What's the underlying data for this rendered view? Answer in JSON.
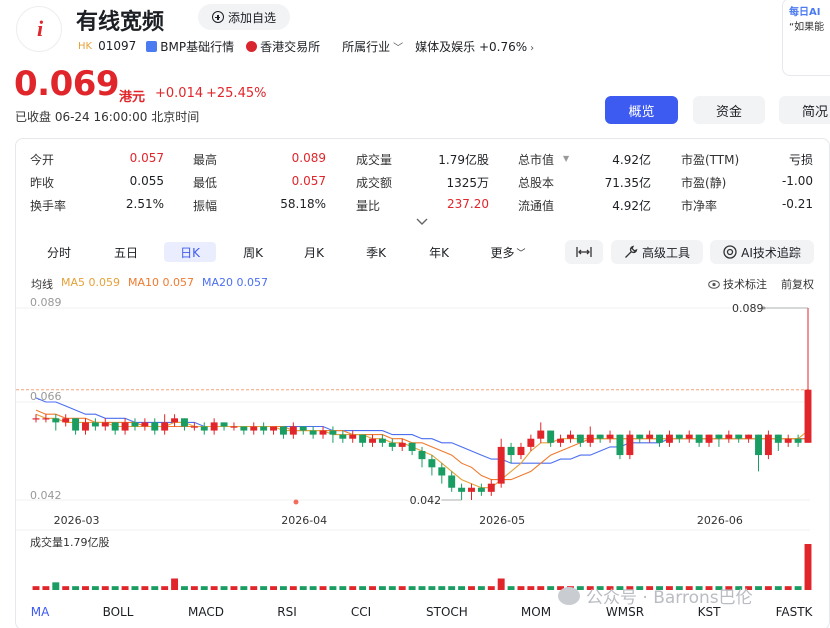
{
  "header": {
    "logo_text": "i",
    "stock_name": "有线宽频",
    "add_watchlist": "添加自选",
    "market_tag": "HK",
    "code": "01097",
    "quote_source": "BMP基础行情",
    "exchange": "香港交易所",
    "industry_label": "所属行业",
    "industry_value": "媒体及娱乐 +0.76%",
    "side_card_title": "每日AI",
    "side_card_text": "“如果能"
  },
  "price": {
    "last": "0.069",
    "unit": "港元",
    "change": "+0.014",
    "change_pct": "+25.45%",
    "status": "已收盘 06-24 16:00:00 北京时间"
  },
  "tabs": {
    "overview": "概览",
    "funds": "资金",
    "brief": "简况"
  },
  "quote": {
    "rows": [
      [
        {
          "label": "今开",
          "value": "0.057",
          "color": "red"
        },
        {
          "label": "最高",
          "value": "0.089",
          "color": "red"
        },
        {
          "label": "成交量",
          "value": "1.79亿股",
          "color": "black"
        },
        {
          "label": "总市值",
          "value": "4.92亿",
          "color": "black"
        },
        {
          "label": "市盈(TTM)",
          "value": "亏损",
          "color": "black"
        }
      ],
      [
        {
          "label": "昨收",
          "value": "0.055",
          "color": "black"
        },
        {
          "label": "最低",
          "value": "0.057",
          "color": "red"
        },
        {
          "label": "成交额",
          "value": "1325万",
          "color": "black"
        },
        {
          "label": "总股本",
          "value": "71.35亿",
          "color": "black"
        },
        {
          "label": "市盈(静)",
          "value": "-1.00",
          "color": "black"
        }
      ],
      [
        {
          "label": "换手率",
          "value": "2.51%",
          "color": "black"
        },
        {
          "label": "振幅",
          "value": "58.18%",
          "color": "black"
        },
        {
          "label": "量比",
          "value": "237.20",
          "color": "red"
        },
        {
          "label": "流通值",
          "value": "4.92亿",
          "color": "black"
        },
        {
          "label": "市净率",
          "value": "-0.21",
          "color": "black"
        }
      ]
    ]
  },
  "periods": [
    "分时",
    "五日",
    "日K",
    "周K",
    "月K",
    "季K",
    "年K",
    "更多"
  ],
  "active_period": "日K",
  "tools": {
    "fit": "",
    "advanced": "高级工具",
    "ai_trace": "AI技术追踪"
  },
  "legend": {
    "ma_title": "均线",
    "ma5": "MA5 0.059",
    "ma10": "MA10 0.057",
    "ma20": "MA20 0.057",
    "tech_note": "技术标注",
    "adjust": "前复权",
    "ma5_color": "#e5a13a",
    "ma10_color": "#f07a2e",
    "ma20_color": "#4b6ff0"
  },
  "chart_data": {
    "type": "candlestick",
    "y_ticks": [
      "0.089",
      "0.066",
      "0.042"
    ],
    "x_ticks": [
      "2026-03",
      "2026-04",
      "2026-05",
      "2026-06"
    ],
    "high_label": "0.089",
    "low_label": "0.042",
    "volume_label": "成交量1.79亿股",
    "up_color": "#e0262b",
    "down_color": "#1a9d63",
    "candles": [
      [
        0.062,
        0.062,
        0.063,
        0.061
      ],
      [
        0.062,
        0.062,
        0.063,
        0.061
      ],
      [
        0.062,
        0.061,
        0.063,
        0.059
      ],
      [
        0.061,
        0.062,
        0.063,
        0.06
      ],
      [
        0.062,
        0.059,
        0.062,
        0.058
      ],
      [
        0.059,
        0.061,
        0.062,
        0.058
      ],
      [
        0.061,
        0.06,
        0.062,
        0.059
      ],
      [
        0.06,
        0.061,
        0.062,
        0.059
      ],
      [
        0.061,
        0.059,
        0.061,
        0.058
      ],
      [
        0.059,
        0.061,
        0.062,
        0.058
      ],
      [
        0.061,
        0.06,
        0.062,
        0.059
      ],
      [
        0.06,
        0.061,
        0.062,
        0.059
      ],
      [
        0.061,
        0.059,
        0.062,
        0.058
      ],
      [
        0.059,
        0.061,
        0.063,
        0.058
      ],
      [
        0.061,
        0.062,
        0.063,
        0.06
      ],
      [
        0.062,
        0.06,
        0.062,
        0.059
      ],
      [
        0.06,
        0.06,
        0.061,
        0.059
      ],
      [
        0.06,
        0.059,
        0.061,
        0.058
      ],
      [
        0.059,
        0.061,
        0.062,
        0.058
      ],
      [
        0.061,
        0.06,
        0.061,
        0.059
      ],
      [
        0.06,
        0.06,
        0.061,
        0.059
      ],
      [
        0.06,
        0.059,
        0.06,
        0.058
      ],
      [
        0.059,
        0.06,
        0.061,
        0.058
      ],
      [
        0.06,
        0.059,
        0.061,
        0.058
      ],
      [
        0.059,
        0.06,
        0.06,
        0.058
      ],
      [
        0.06,
        0.058,
        0.06,
        0.057
      ],
      [
        0.058,
        0.06,
        0.061,
        0.057
      ],
      [
        0.06,
        0.059,
        0.06,
        0.058
      ],
      [
        0.059,
        0.058,
        0.06,
        0.057
      ],
      [
        0.058,
        0.059,
        0.06,
        0.057
      ],
      [
        0.059,
        0.058,
        0.06,
        0.056
      ],
      [
        0.058,
        0.057,
        0.059,
        0.056
      ],
      [
        0.057,
        0.058,
        0.059,
        0.056
      ],
      [
        0.058,
        0.056,
        0.058,
        0.055
      ],
      [
        0.056,
        0.057,
        0.058,
        0.055
      ],
      [
        0.057,
        0.056,
        0.058,
        0.055
      ],
      [
        0.056,
        0.055,
        0.057,
        0.054
      ],
      [
        0.055,
        0.056,
        0.057,
        0.054
      ],
      [
        0.056,
        0.054,
        0.056,
        0.053
      ],
      [
        0.054,
        0.052,
        0.055,
        0.05
      ],
      [
        0.052,
        0.05,
        0.053,
        0.048
      ],
      [
        0.05,
        0.048,
        0.051,
        0.046
      ],
      [
        0.048,
        0.045,
        0.049,
        0.044
      ],
      [
        0.045,
        0.044,
        0.046,
        0.042
      ],
      [
        0.044,
        0.045,
        0.046,
        0.042
      ],
      [
        0.045,
        0.044,
        0.046,
        0.043
      ],
      [
        0.044,
        0.046,
        0.047,
        0.043
      ],
      [
        0.046,
        0.055,
        0.057,
        0.045
      ],
      [
        0.055,
        0.053,
        0.056,
        0.051
      ],
      [
        0.053,
        0.055,
        0.056,
        0.052
      ],
      [
        0.055,
        0.057,
        0.058,
        0.054
      ],
      [
        0.057,
        0.059,
        0.061,
        0.056
      ],
      [
        0.059,
        0.056,
        0.059,
        0.055
      ],
      [
        0.056,
        0.057,
        0.058,
        0.055
      ],
      [
        0.057,
        0.058,
        0.059,
        0.056
      ],
      [
        0.058,
        0.056,
        0.058,
        0.055
      ],
      [
        0.056,
        0.058,
        0.06,
        0.055
      ],
      [
        0.058,
        0.057,
        0.058,
        0.056
      ],
      [
        0.057,
        0.058,
        0.059,
        0.056
      ],
      [
        0.058,
        0.053,
        0.058,
        0.052
      ],
      [
        0.053,
        0.058,
        0.059,
        0.052
      ],
      [
        0.058,
        0.057,
        0.058,
        0.056
      ],
      [
        0.057,
        0.058,
        0.059,
        0.056
      ],
      [
        0.058,
        0.056,
        0.058,
        0.055
      ],
      [
        0.056,
        0.058,
        0.059,
        0.055
      ],
      [
        0.058,
        0.057,
        0.058,
        0.056
      ],
      [
        0.057,
        0.058,
        0.059,
        0.056
      ],
      [
        0.058,
        0.056,
        0.058,
        0.055
      ],
      [
        0.056,
        0.058,
        0.058,
        0.055
      ],
      [
        0.058,
        0.057,
        0.058,
        0.055
      ],
      [
        0.057,
        0.058,
        0.059,
        0.056
      ],
      [
        0.058,
        0.057,
        0.058,
        0.056
      ],
      [
        0.057,
        0.058,
        0.058,
        0.056
      ],
      [
        0.058,
        0.053,
        0.058,
        0.049
      ],
      [
        0.053,
        0.058,
        0.059,
        0.052
      ],
      [
        0.058,
        0.056,
        0.058,
        0.054
      ],
      [
        0.056,
        0.057,
        0.058,
        0.055
      ],
      [
        0.057,
        0.056,
        0.058,
        0.055
      ],
      [
        0.056,
        0.069,
        0.089,
        0.056
      ]
    ],
    "ma5": [
      0.063,
      0.062,
      0.062,
      0.061,
      0.061,
      0.061,
      0.061,
      0.061,
      0.06,
      0.06,
      0.06,
      0.06,
      0.06,
      0.06,
      0.061,
      0.061,
      0.06,
      0.06,
      0.06,
      0.06,
      0.06,
      0.06,
      0.06,
      0.06,
      0.06,
      0.059,
      0.059,
      0.059,
      0.059,
      0.059,
      0.058,
      0.058,
      0.058,
      0.058,
      0.057,
      0.057,
      0.056,
      0.056,
      0.055,
      0.054,
      0.053,
      0.051,
      0.049,
      0.047,
      0.046,
      0.045,
      0.045,
      0.047,
      0.049,
      0.051,
      0.054,
      0.056,
      0.056,
      0.057,
      0.057,
      0.057,
      0.057,
      0.057,
      0.057,
      0.057,
      0.057,
      0.057,
      0.057,
      0.057,
      0.057,
      0.057,
      0.057,
      0.057,
      0.057,
      0.057,
      0.057,
      0.057,
      0.057,
      0.057,
      0.057,
      0.057,
      0.057,
      0.057,
      0.059
    ],
    "ma10": [
      0.064,
      0.063,
      0.063,
      0.062,
      0.062,
      0.062,
      0.061,
      0.061,
      0.061,
      0.061,
      0.061,
      0.06,
      0.06,
      0.06,
      0.06,
      0.06,
      0.06,
      0.06,
      0.06,
      0.06,
      0.06,
      0.06,
      0.06,
      0.06,
      0.06,
      0.06,
      0.059,
      0.059,
      0.059,
      0.059,
      0.059,
      0.059,
      0.058,
      0.058,
      0.058,
      0.058,
      0.057,
      0.057,
      0.056,
      0.056,
      0.055,
      0.054,
      0.053,
      0.051,
      0.05,
      0.048,
      0.047,
      0.047,
      0.047,
      0.048,
      0.049,
      0.051,
      0.053,
      0.054,
      0.055,
      0.056,
      0.057,
      0.057,
      0.057,
      0.057,
      0.057,
      0.057,
      0.057,
      0.057,
      0.057,
      0.057,
      0.057,
      0.057,
      0.057,
      0.057,
      0.057,
      0.057,
      0.057,
      0.057,
      0.057,
      0.057,
      0.057,
      0.057,
      0.057
    ],
    "ma20": [
      0.067,
      0.066,
      0.066,
      0.065,
      0.064,
      0.063,
      0.063,
      0.062,
      0.062,
      0.062,
      0.061,
      0.061,
      0.061,
      0.061,
      0.061,
      0.061,
      0.061,
      0.06,
      0.06,
      0.06,
      0.06,
      0.06,
      0.06,
      0.06,
      0.06,
      0.06,
      0.06,
      0.06,
      0.06,
      0.06,
      0.059,
      0.059,
      0.059,
      0.059,
      0.059,
      0.059,
      0.058,
      0.058,
      0.058,
      0.057,
      0.057,
      0.056,
      0.056,
      0.055,
      0.054,
      0.053,
      0.052,
      0.052,
      0.051,
      0.051,
      0.051,
      0.051,
      0.051,
      0.052,
      0.052,
      0.053,
      0.053,
      0.054,
      0.055,
      0.055,
      0.056,
      0.056,
      0.056,
      0.056,
      0.057,
      0.057,
      0.057,
      0.057,
      0.057,
      0.057,
      0.057,
      0.057,
      0.057,
      0.057,
      0.057,
      0.057,
      0.057,
      0.057,
      0.057
    ],
    "volumes": [
      1,
      1,
      2,
      1,
      1,
      1,
      1,
      1,
      1,
      1,
      1,
      1,
      1,
      1,
      3,
      1,
      1,
      1,
      1,
      1,
      1,
      1,
      1,
      1,
      1,
      1,
      1,
      1,
      1,
      1,
      1,
      1,
      1,
      1,
      1,
      1,
      1,
      1,
      1,
      1,
      1,
      1,
      1,
      1,
      1,
      1,
      1,
      3,
      1,
      1,
      1,
      1,
      1,
      1,
      1,
      1,
      1,
      1,
      1,
      1,
      1,
      1,
      1,
      1,
      1,
      1,
      1,
      1,
      1,
      1,
      1,
      1,
      1,
      1,
      1,
      1,
      1,
      1,
      12
    ]
  },
  "indicators": [
    "MA",
    "BOLL",
    "MACD",
    "RSI",
    "CCI",
    "STOCH",
    "MOM",
    "WMSR",
    "KST",
    "FASTK"
  ],
  "active_indicator": "MA",
  "watermark": "公众号 · Barrons巴伦"
}
